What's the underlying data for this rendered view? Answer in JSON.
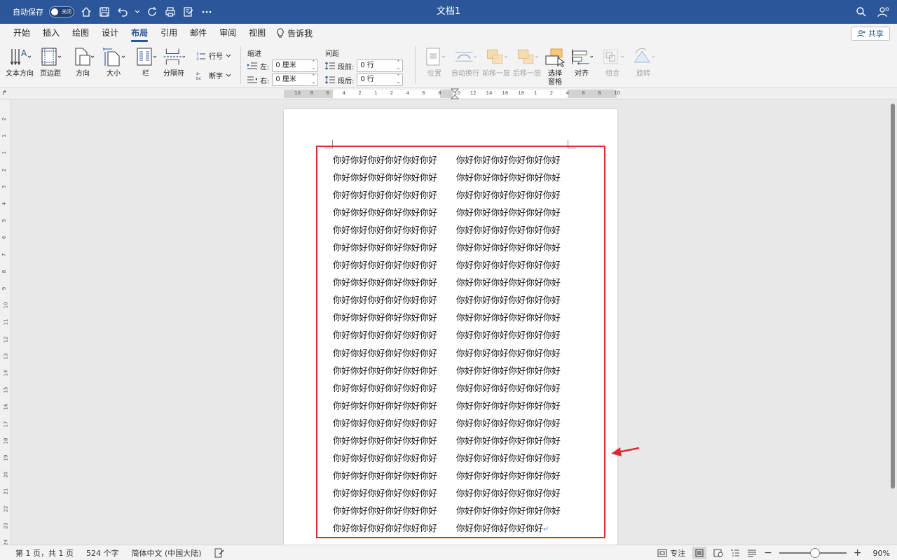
{
  "titlebar": {
    "autosave_label": "自动保存",
    "autosave_state": "关闭",
    "doc_title": "文档1"
  },
  "tabs": [
    {
      "label": "开始"
    },
    {
      "label": "插入"
    },
    {
      "label": "绘图"
    },
    {
      "label": "设计"
    },
    {
      "label": "布局"
    },
    {
      "label": "引用"
    },
    {
      "label": "邮件"
    },
    {
      "label": "审阅"
    },
    {
      "label": "视图"
    }
  ],
  "active_tab": "布局",
  "tell_me": "告诉我",
  "share_label": "共享",
  "ribbon": {
    "text_direction": "文本方向",
    "margins": "页边距",
    "orientation": "方向",
    "size": "大小",
    "columns": "栏",
    "breaks": "分隔符",
    "line_numbers": "行号",
    "hyphenation": "断字",
    "indent_title": "缩进",
    "indent_left_label": "左:",
    "indent_left_value": "0 厘米",
    "indent_right_label": "右:",
    "indent_right_value": "0 厘米",
    "spacing_title": "间距",
    "spacing_before_label": "段前:",
    "spacing_before_value": "0 行",
    "spacing_after_label": "段后:",
    "spacing_after_value": "0 行",
    "position": "位置",
    "wrap_text": "自动换行",
    "bring_forward": "前移一层",
    "send_backward": "后移一层",
    "selection_pane_1": "选择",
    "selection_pane_2": "窗格",
    "align": "对齐",
    "group": "组合",
    "rotate": "旋转"
  },
  "document": {
    "left_column": [
      "你好你好你好你好你好你好",
      "你好你好你好你好你好你好",
      "你好你好你好你好你好你好",
      "你好你好你好你好你好你好",
      "你好你好你好你好你好你好",
      "你好你好你好你好你好你好",
      "你好你好你好你好你好你好",
      "你好你好你好你好你好你好",
      "你好你好你好你好你好你好",
      "你好你好你好你好你好你好",
      "你好你好你好你好你好你好",
      "你好你好你好你好你好你好",
      "你好你好你好你好你好你好",
      "你好你好你好你好你好你好",
      "你好你好你好你好你好你好",
      "你好你好你好你好你好你好",
      "你好你好你好你好你好你好",
      "你好你好你好你好你好你好",
      "你好你好你好你好你好你好",
      "你好你好你好你好你好你好",
      "你好你好你好你好你好你好",
      "你好你好你好你好你好你好"
    ],
    "right_column": [
      "你好你好你好你好你好你好",
      "你好你好你好你好你好你好",
      "你好你好你好你好你好你好",
      "你好你好你好你好你好你好",
      "你好你好你好你好你好你好",
      "你好你好你好你好你好你好",
      "你好你好你好你好你好你好",
      "你好你好你好你好你好你好",
      "你好你好你好你好你好你好",
      "你好你好你好你好你好你好",
      "你好你好你好你好你好你好",
      "你好你好你好你好你好你好",
      "你好你好你好你好你好你好",
      "你好你好你好你好你好你好",
      "你好你好你好你好你好你好",
      "你好你好你好你好你好你好",
      "你好你好你好你好你好你好",
      "你好你好你好你好你好你好",
      "你好你好你好你好你好你好",
      "你好你好你好你好你好你好",
      "你好你好你好你好你好你好",
      "你好你好你好你好你好"
    ],
    "paragraph_mark": "↵"
  },
  "hruler_ticks": [
    "10",
    "8",
    "6",
    "4",
    "2",
    "1",
    "2",
    "4",
    "6",
    "8",
    "10",
    "12",
    "14",
    "16",
    "18",
    "1",
    "2",
    "4",
    "6",
    "8",
    "10"
  ],
  "vruler_ticks": [
    "2",
    "1",
    "1",
    "2",
    "3",
    "4",
    "5",
    "6",
    "7",
    "8",
    "9",
    "10",
    "11",
    "12",
    "13",
    "14",
    "15",
    "16",
    "17",
    "18",
    "19",
    "20",
    "21",
    "22",
    "23",
    "24"
  ],
  "status": {
    "page": "第 1 页，共 1 页",
    "words": "524 个字",
    "language": "简体中文 (中国大陆)",
    "focus": "专注",
    "zoom": "90%"
  },
  "colors": {
    "brand": "#2b579a",
    "highlight": "#e0282e"
  }
}
